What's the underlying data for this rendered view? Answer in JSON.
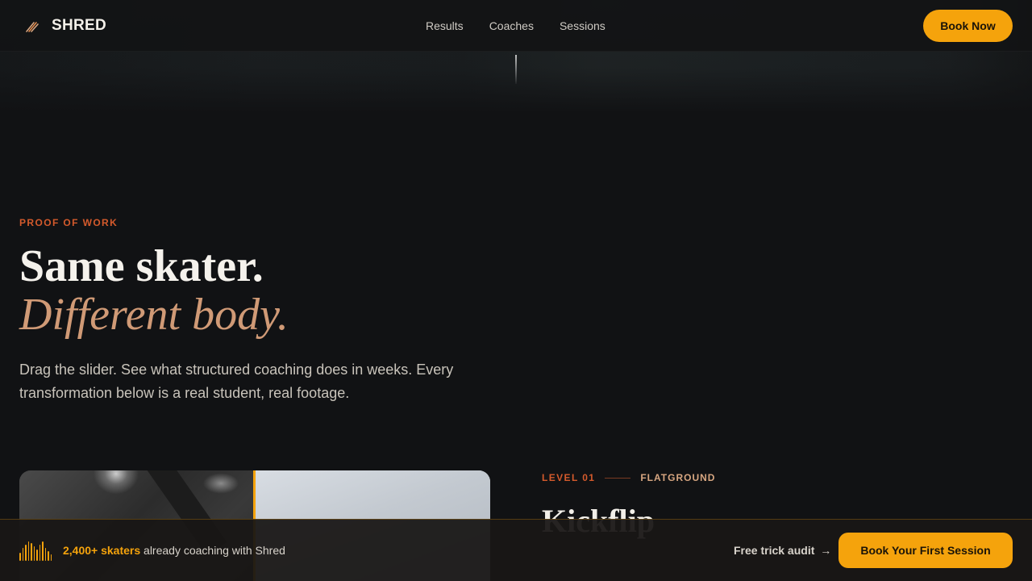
{
  "brand": {
    "name": "SHRED",
    "icon": "brand-slash-logo"
  },
  "nav": {
    "items": [
      "Results",
      "Coaches",
      "Sessions"
    ]
  },
  "header": {
    "cta_label": "Book Now"
  },
  "intro": {
    "eyebrow": "PROOF OF WORK",
    "headline_line1": "Same skater.",
    "headline_line2": "Different body.",
    "lead": "Drag the slider. See what structured coaching does in weeks. Every transformation below is a real student, real footage."
  },
  "transformation": {
    "level_label": "LEVEL 01",
    "category": "FLATGROUND",
    "trick_title": "Kickflip",
    "slider_position": 0.5
  },
  "sticky_bar": {
    "count_highlight": "2,400+ skaters",
    "count_text": "already coaching with Shred",
    "audit_label": "Free trick audit",
    "audit_arrow": "→",
    "cta_label": "Book Your First Session",
    "icon": "equalizer-bars-icon"
  },
  "colors": {
    "accent": "#f5a30c",
    "eyebrow": "#d45a2c",
    "italic_headline": "#d09a76",
    "background": "#111214"
  }
}
